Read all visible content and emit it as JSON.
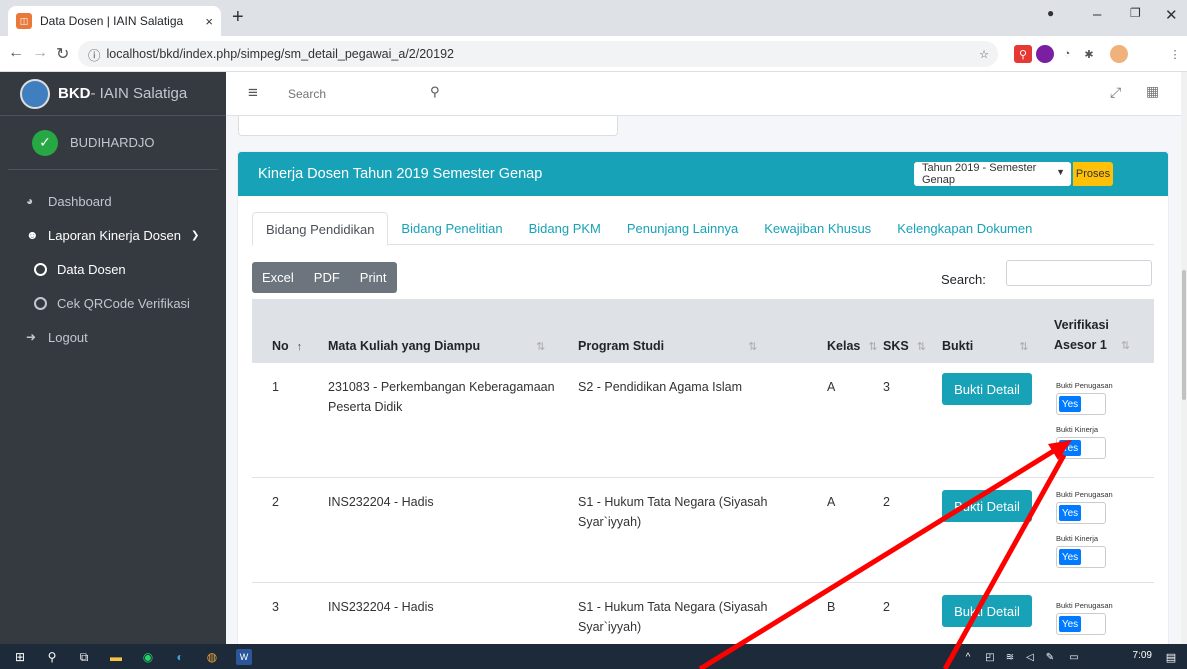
{
  "browser": {
    "tab_title": "Data Dosen | IAIN Salatiga",
    "tab_close": "×",
    "new_tab": "+",
    "url": "localhost/bkd/index.php/simpeg/sm_detail_pegawai_a/2/20192"
  },
  "sidebar": {
    "brand_bold": "BKD",
    "brand_rest": " - IAIN Salatiga",
    "user_name": "BUDIHARDJO",
    "items": [
      {
        "label": "Dashboard",
        "icon": "dashboard-icon"
      },
      {
        "label": "Laporan Kinerja Dosen",
        "icon": "users-icon"
      },
      {
        "label": "Data Dosen",
        "icon": "circle-icon"
      },
      {
        "label": "Cek QRCode Verifikasi",
        "icon": "circle-icon"
      },
      {
        "label": "Logout",
        "icon": "logout-icon"
      }
    ]
  },
  "topnav": {
    "search_placeholder": "Search"
  },
  "card": {
    "title": "Kinerja Dosen  Tahun 2019 Semester Genap",
    "period_select": "Tahun 2019 - Semester Genap",
    "proses_label": "Proses"
  },
  "tabs": [
    "Bidang Pendidikan",
    "Bidang Penelitian",
    "Bidang PKM",
    "Penunjang Lainnya",
    "Kewajiban Khusus",
    "Kelengkapan Dokumen"
  ],
  "export_buttons": [
    "Excel",
    "PDF",
    "Print"
  ],
  "search_label": "Search:",
  "table": {
    "headers": {
      "no": "No",
      "mk": "Mata Kuliah yang Diampu",
      "prodi": "Program Studi",
      "kelas": "Kelas",
      "sks": "SKS",
      "bukti": "Bukti",
      "verif1": "Verifikasi",
      "verif2": "Asesor 1"
    },
    "rows": [
      {
        "no": "1",
        "mk": "231083 - Perkembangan Keberagamaan Peserta Didik",
        "prodi": "S2 - Pendidikan Agama Islam",
        "kelas": "A",
        "sks": "3"
      },
      {
        "no": "2",
        "mk": "INS232204 - Hadis",
        "prodi": "S1 - Hukum Tata Negara (Siyasah Syar`iyyah)",
        "kelas": "A",
        "sks": "2"
      },
      {
        "no": "3",
        "mk": "INS232204 - Hadis",
        "prodi": "S1 - Hukum Tata Negara (Siyasah Syar`iyyah)",
        "kelas": "B",
        "sks": "2"
      }
    ],
    "bukti_button": "Bukti Detail",
    "label_penugasan": "Bukti Penugasan",
    "label_kinerja": "Bukti Kinerja",
    "toggle_yes": "Yes"
  },
  "taskbar": {
    "time": "7:09"
  },
  "colors": {
    "accent": "#17a2b8",
    "sidebar": "#343a40",
    "annotation": "#ff0000"
  }
}
